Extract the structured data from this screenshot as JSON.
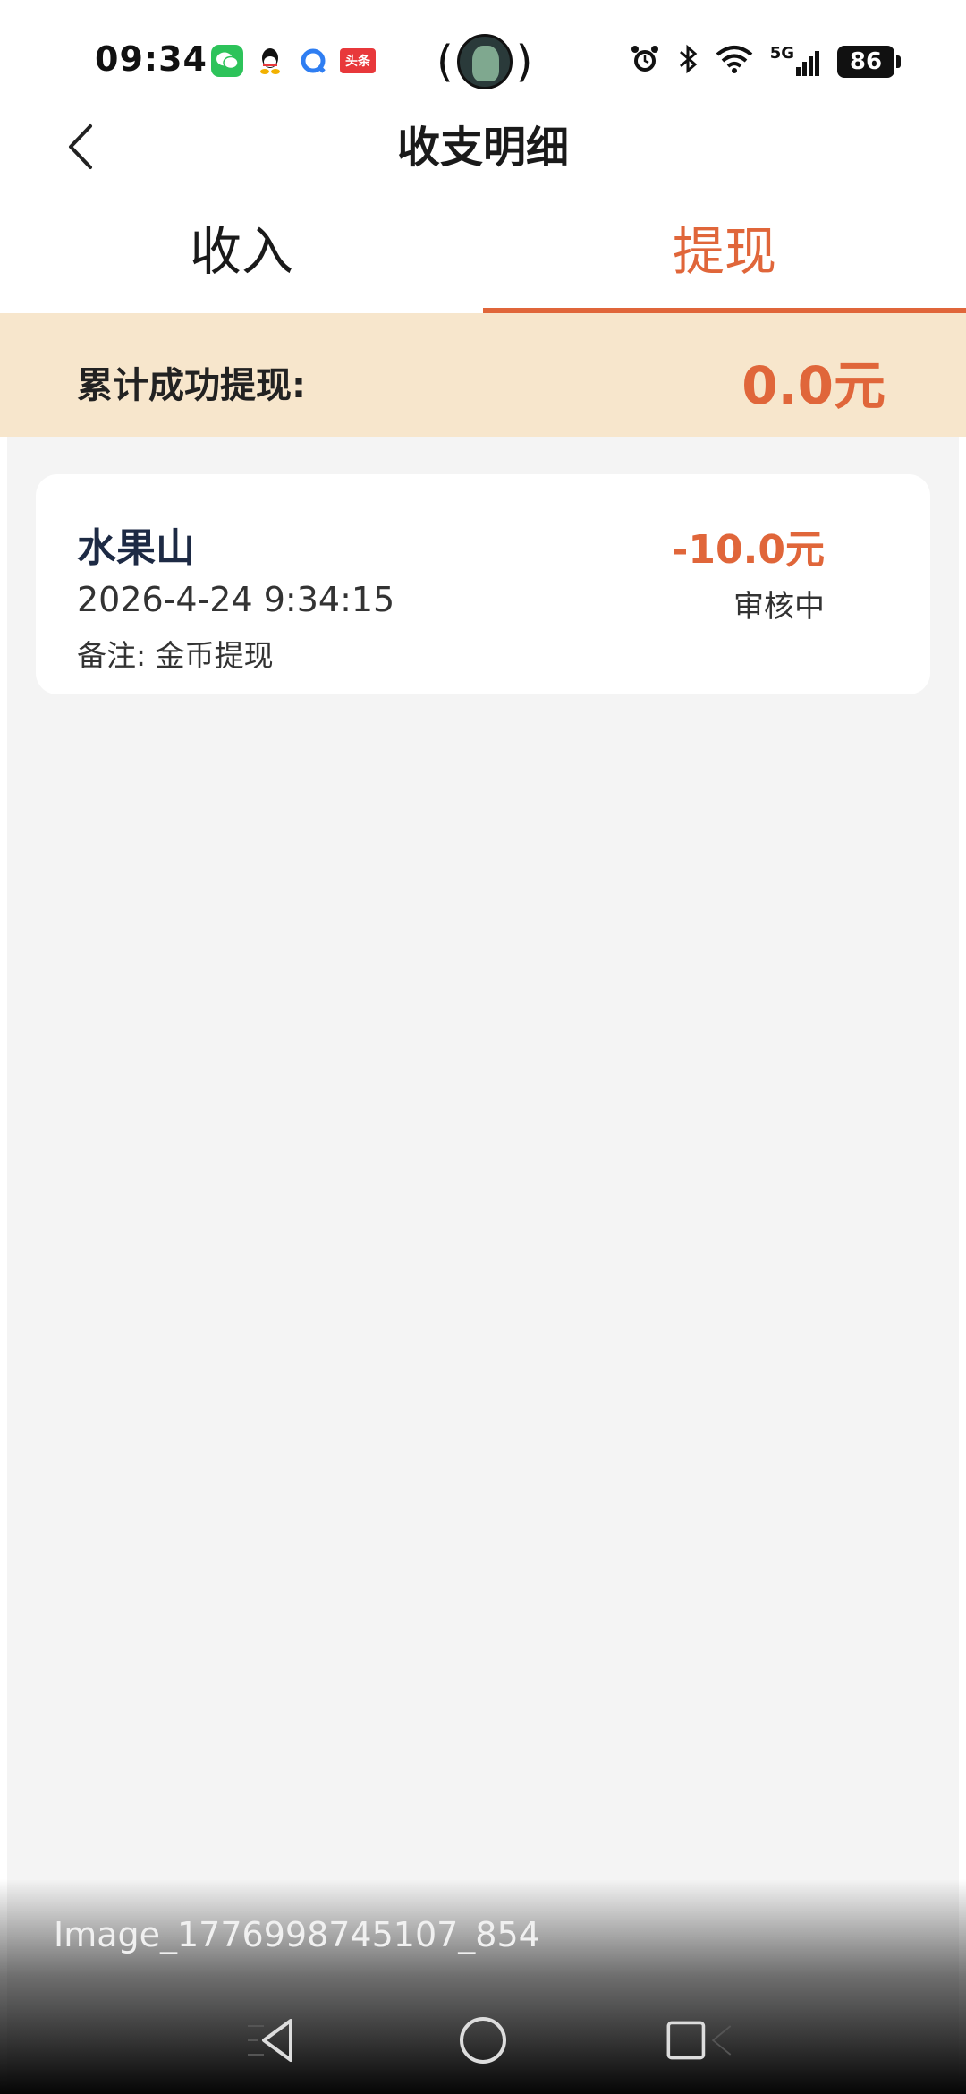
{
  "status_bar": {
    "time": "09:34",
    "toutiao_label": "头条",
    "network": "5G",
    "battery": "86"
  },
  "header": {
    "title": "收支明细"
  },
  "tabs": [
    {
      "label": "收入",
      "active": false
    },
    {
      "label": "提现",
      "active": true
    }
  ],
  "summary": {
    "label": "累计成功提现:",
    "value": "0.0元"
  },
  "records": [
    {
      "name": "水果山",
      "time": "2026-4-24 9:34:15",
      "note": "备注: 金币提现",
      "amount": "-10.0元",
      "status": "审核中"
    }
  ],
  "watermark": "Image_1776998745107_854",
  "colors": {
    "accent": "#e0663a",
    "summary_bg": "#f7e6cc",
    "page_bg": "#f4f4f4"
  }
}
